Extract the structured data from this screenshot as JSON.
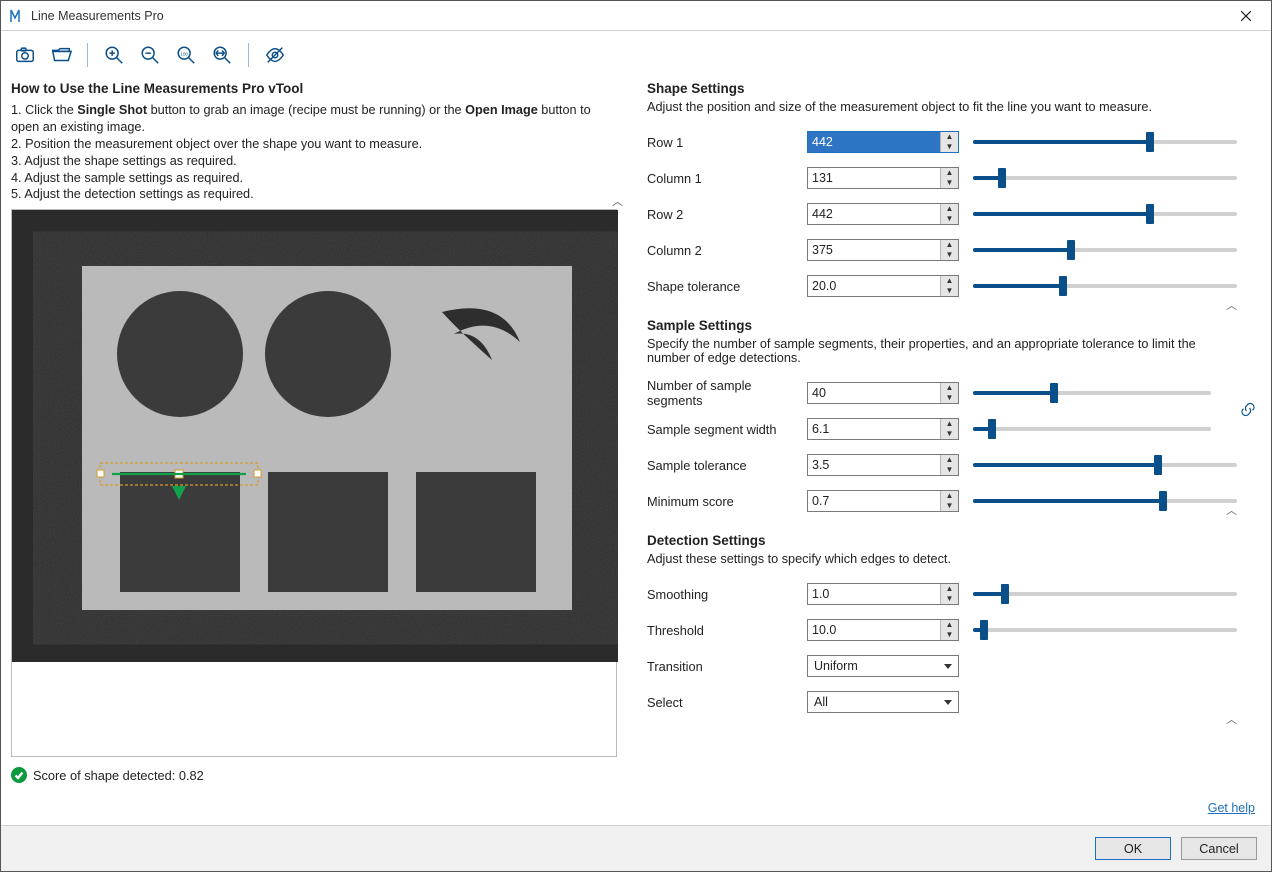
{
  "window": {
    "title": "Line Measurements Pro"
  },
  "howto": {
    "title": "How to Use the Line Measurements Pro vTool",
    "line1a": "1. Click the ",
    "line1b": "Single Shot",
    "line1c": " button to grab an image (recipe must be running) or the ",
    "line1d": "Open Image",
    "line1e": " button to open an existing image.",
    "line2": "2. Position the measurement object over the shape you want to measure.",
    "line3": "3. Adjust the shape settings as required.",
    "line4": "4. Adjust the sample settings as required.",
    "line5": "5. Adjust the detection settings as required."
  },
  "status": {
    "text": "Score of shape detected: 0.82"
  },
  "shape": {
    "title": "Shape Settings",
    "desc": "Adjust the position and size of the measurement object to fit the line you want to measure.",
    "rows": {
      "row1": {
        "label": "Row 1",
        "value": "442",
        "fill": 67
      },
      "col1": {
        "label": "Column 1",
        "value": "131",
        "fill": 11
      },
      "row2": {
        "label": "Row 2",
        "value": "442",
        "fill": 67
      },
      "col2": {
        "label": "Column 2",
        "value": "375",
        "fill": 37
      },
      "tol": {
        "label": "Shape tolerance",
        "value": "20.0",
        "fill": 34
      }
    }
  },
  "sample": {
    "title": "Sample Settings",
    "desc": "Specify the number of sample segments, their properties, and an appropriate tolerance to limit the number of edge detections.",
    "rows": {
      "nseg": {
        "label": "Number of sample segments",
        "value": "40",
        "fill": 34
      },
      "segw": {
        "label": "Sample segment width",
        "value": "6.1",
        "fill": 8
      },
      "stol": {
        "label": "Sample tolerance",
        "value": "3.5",
        "fill": 70
      },
      "mins": {
        "label": "Minimum score",
        "value": "0.7",
        "fill": 72
      }
    }
  },
  "detect": {
    "title": "Detection Settings",
    "desc": "Adjust these settings to specify which edges to detect.",
    "rows": {
      "smooth": {
        "label": "Smoothing",
        "value": "1.0",
        "fill": 12
      },
      "thresh": {
        "label": "Threshold",
        "value": "10.0",
        "fill": 4
      }
    },
    "transition": {
      "label": "Transition",
      "value": "Uniform"
    },
    "select": {
      "label": "Select",
      "value": "All"
    }
  },
  "footer": {
    "ok": "OK",
    "cancel": "Cancel",
    "help": "Get help"
  },
  "colors": {
    "accent": "#0b4f8a",
    "highlight": "#2d74c4"
  }
}
